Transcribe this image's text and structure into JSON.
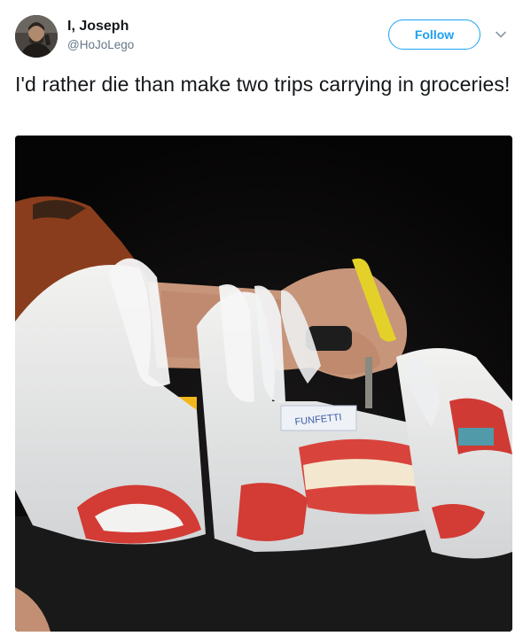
{
  "author": {
    "display_name": "I, Joseph",
    "handle": "@HoJoLego"
  },
  "actions": {
    "follow_label": "Follow",
    "menu_icon": "chevron-down-icon"
  },
  "tweet": {
    "text": "I'd rather die than make two trips carrying in groceries!"
  },
  "media": {
    "bag_print": "FUNFETTI"
  },
  "colors": {
    "accent": "#1da1f2",
    "text": "#14171a",
    "secondary_text": "#657786"
  }
}
